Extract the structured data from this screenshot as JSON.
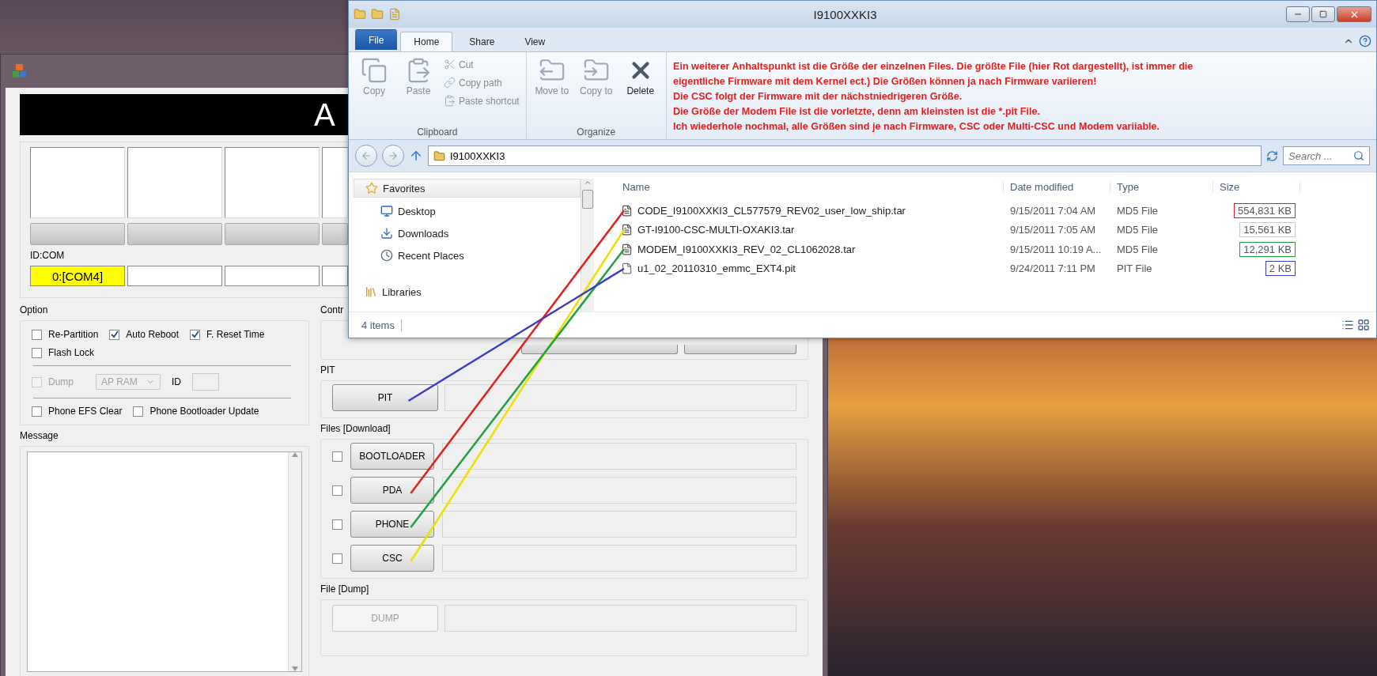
{
  "odin": {
    "header": "A",
    "ports": [
      {
        "active": true,
        "id_com": "0:[COM4]",
        "level": 0
      },
      {
        "active": false,
        "level": 0
      },
      {
        "active": false,
        "level": 0
      },
      {
        "active": false,
        "level": 0
      }
    ],
    "id_com_label": "ID:COM",
    "option": {
      "title": "Option",
      "checkboxes": [
        {
          "label": "Re-Partition",
          "checked": false
        },
        {
          "label": "Auto Reboot",
          "checked": true
        },
        {
          "label": "F. Reset Time",
          "checked": true
        },
        {
          "label": "Flash Lock",
          "checked": false
        }
      ],
      "dump": {
        "label": "Dump",
        "checked": false,
        "disabled": true,
        "select": "AP RAM",
        "id_label": "ID"
      },
      "phone": [
        {
          "label": "Phone EFS Clear",
          "checked": false
        },
        {
          "label": "Phone Bootloader Update",
          "checked": false
        }
      ]
    },
    "message": {
      "title": "Message"
    },
    "control": {
      "title": "Contr"
    },
    "pit": {
      "title": "PIT",
      "button": "PIT"
    },
    "files": {
      "title": "Files [Download]",
      "rows": [
        {
          "button": "BOOTLOADER",
          "checked": false
        },
        {
          "button": "PDA",
          "checked": false
        },
        {
          "button": "PHONE",
          "checked": false
        },
        {
          "button": "CSC",
          "checked": false
        }
      ]
    },
    "dump": {
      "title": "File [Dump]",
      "button": "DUMP",
      "disabled": true
    }
  },
  "explorer": {
    "title": "I9100XXKI3",
    "tabs": [
      {
        "label": "File",
        "kind": "file",
        "selected": false
      },
      {
        "label": "Home",
        "kind": "tab",
        "selected": true
      },
      {
        "label": "Share",
        "kind": "tab",
        "selected": false
      },
      {
        "label": "View",
        "kind": "tab",
        "selected": false
      }
    ],
    "ribbon": [
      {
        "label": "Clipboard",
        "items": [
          {
            "label": "Copy",
            "kind": "large",
            "disabled": true
          },
          {
            "label": "Paste",
            "kind": "large",
            "disabled": true
          },
          {
            "label": "Cut",
            "kind": "small",
            "disabled": true
          },
          {
            "label": "Copy path",
            "kind": "small",
            "disabled": true
          },
          {
            "label": "Paste shortcut",
            "kind": "small",
            "disabled": true
          }
        ]
      },
      {
        "label": "Organize",
        "items": [
          {
            "label": "Move to",
            "kind": "large",
            "disabled": true
          },
          {
            "label": "Copy to",
            "kind": "large",
            "disabled": true
          },
          {
            "label": "Delete",
            "kind": "large",
            "disabled": false
          }
        ]
      }
    ],
    "address": "I9100XXKI3",
    "search": {
      "placeholder": "Search ..."
    },
    "nav": [
      {
        "label": "Favorites",
        "selected": true,
        "children": [
          {
            "label": "Desktop",
            "selected": false
          },
          {
            "label": "Downloads",
            "selected": false
          },
          {
            "label": "Recent Places",
            "selected": false
          }
        ]
      },
      {
        "label": "Libraries",
        "selected": false
      }
    ],
    "columns": [
      "Name",
      "Date modified",
      "Type",
      "Size"
    ],
    "files": [
      {
        "name": "CODE_I9100XXKI3_CL577579_REV02_user_low_ship.tar",
        "date": "9/15/2011 7:04 AM",
        "type": "MD5 File",
        "size": "554,831 KB",
        "kind": "md5",
        "color": "#e02020"
      },
      {
        "name": "GT-I9100-CSC-MULTI-OXAKI3.tar",
        "date": "9/15/2011 7:05 AM",
        "type": "MD5 File",
        "size": "15,561 KB",
        "kind": "md5",
        "color": "#f0e000"
      },
      {
        "name": "MODEM_I9100XXKI3_REV_02_CL1062028.tar",
        "date": "9/15/2011 10:19 A...",
        "type": "MD5 File",
        "size": "12,291 KB",
        "kind": "md5",
        "color": "#20a040"
      },
      {
        "name": "u1_02_20110310_emmc_EXT4.pit",
        "date": "9/24/2011 7:11 PM",
        "type": "PIT File",
        "size": "2 KB",
        "kind": "pit",
        "color": "#3c3cc0"
      }
    ],
    "status": "4 items"
  },
  "annotation": [
    "Ein weiterer Anhaltspunkt ist die Größe der einzelnen Files. Die größte File (hier Rot dargestellt), ist immer die",
    "eigentliche Firmware mit dem Kernel ect.) Die Größen können ja nach Firmware variieren!",
    "Die CSC folgt der Firmware mit der nächstniedrigeren Größe.",
    "Die Größe der Modem File ist die vorletzte, denn am kleinsten ist die *.pit File.",
    "Ich wiederhole nochmal, alle Größen sind je nach Firmware, CSC oder Multi-CSC und Modem variiable."
  ]
}
